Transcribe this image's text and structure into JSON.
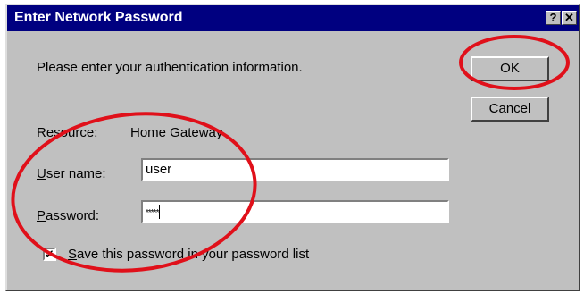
{
  "dialog": {
    "title": "Enter Network Password",
    "help_glyph": "?",
    "close_glyph": "✕",
    "prompt": "Please enter your authentication information.",
    "ok_label": "OK",
    "cancel_label": "Cancel",
    "resource_label": "Resource:",
    "resource_value": "Home Gateway",
    "username_label_accel": "U",
    "username_label_rest": "ser name:",
    "username_value": "user",
    "password_label_accel": "P",
    "password_label_rest": "assword:",
    "password_value": "*****",
    "save_checked": true,
    "save_check_glyph": "✓",
    "save_label_accel": "S",
    "save_label_rest": "ave this password in your password list"
  },
  "annotation": {
    "color": "#e0101a"
  }
}
